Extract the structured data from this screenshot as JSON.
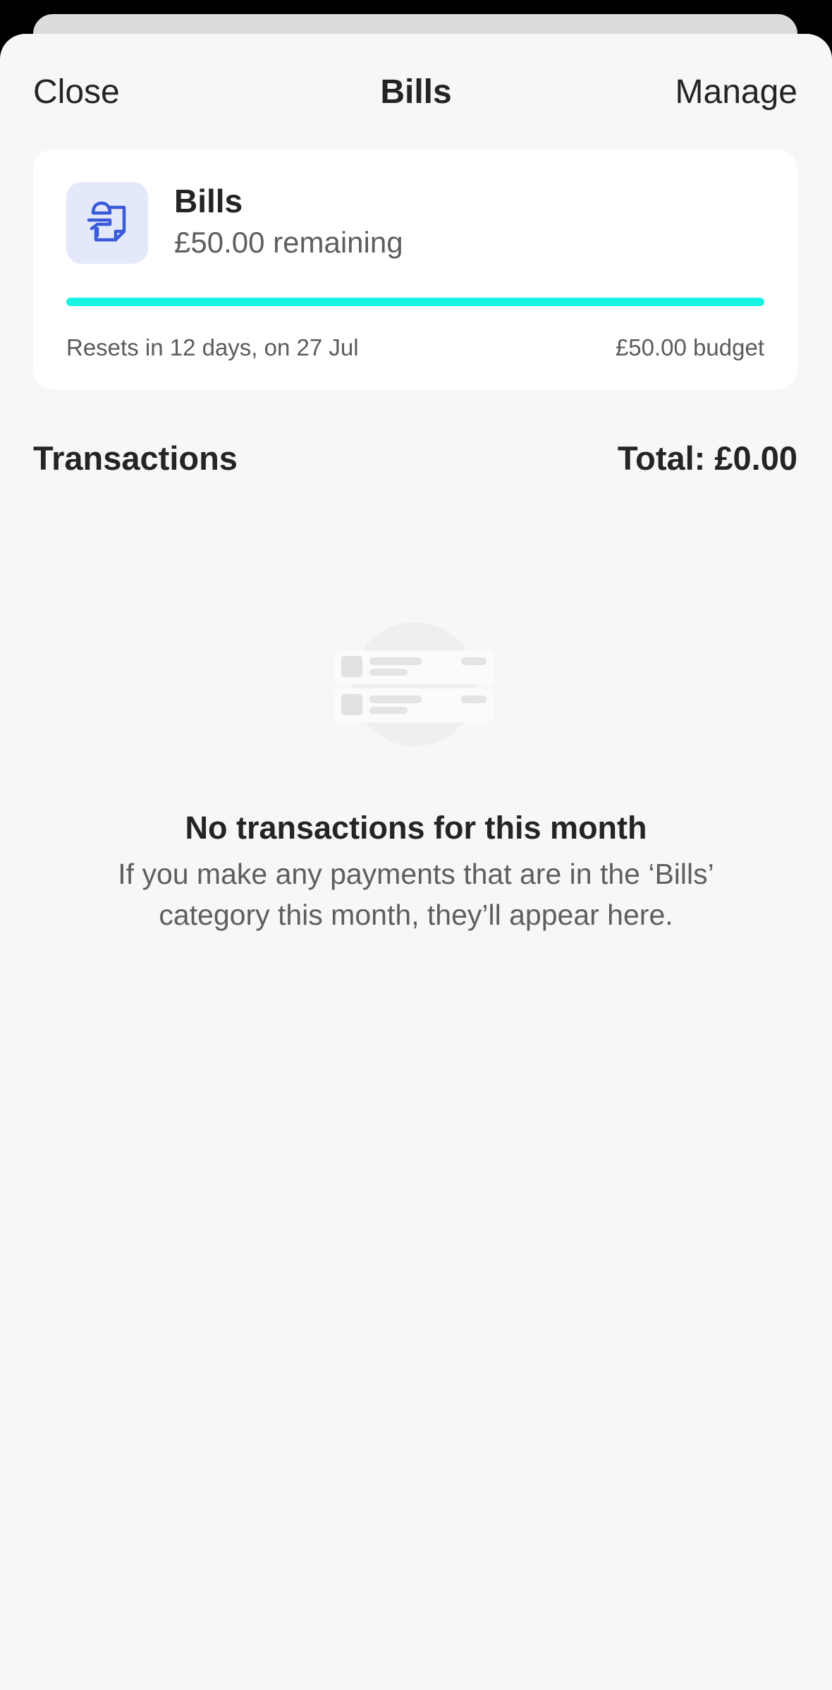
{
  "nav": {
    "close_label": "Close",
    "title": "Bills",
    "manage_label": "Manage"
  },
  "budget": {
    "category_name": "Bills",
    "remaining": "£50.00 remaining",
    "progress_remaining_fraction": 1.0,
    "progress_color": "#16f3e3",
    "reset_text": "Resets in 12 days, on 27 Jul",
    "budget_text": "£50.00 budget",
    "icon": "bills-document-icon",
    "icon_color": "#3a5bd9"
  },
  "transactions": {
    "title": "Transactions",
    "total": "Total: £0.00",
    "empty_illustration_icon": "empty-transactions-list-icon",
    "empty_title": "No transactions for this month",
    "empty_body": "If you make any payments that are in the ‘Bills’ category this month, they’ll appear here."
  }
}
